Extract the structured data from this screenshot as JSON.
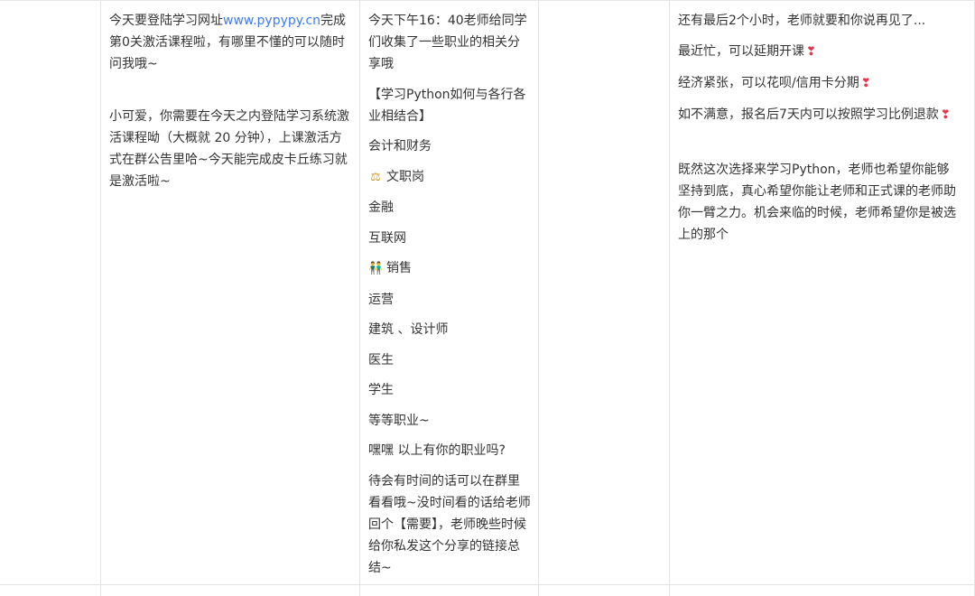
{
  "col1": {
    "p1_before": "今天要登陆学习网址",
    "p1_link": "www.pypypy.cn",
    "p1_after": "完成第0关激活课程啦，有哪里不懂的可以随时问我哦~",
    "p2": "小可爱，你需要在今天之内登陆学习系统激活课程呦（大概就 20 分钟），上课激活方式在群公告里哈~今天能完成皮卡丘练习就是激活啦~"
  },
  "col2": {
    "intro": "今天下午16：40老师给同学们收集了一些职业的相关分享哦",
    "heading": "【学习Python如何与各行各业相结合】",
    "items": [
      {
        "icon": "",
        "text": "会计和财务"
      },
      {
        "icon": "⚖",
        "text": "文职岗"
      },
      {
        "icon": "",
        "text": "金融"
      },
      {
        "icon": "",
        "text": "互联网"
      },
      {
        "icon": "👬",
        "text": "销售"
      },
      {
        "icon": "",
        "text": "运营"
      },
      {
        "icon": "",
        "text": "建筑 、设计师"
      },
      {
        "icon": "",
        "text": "医生"
      },
      {
        "icon": "",
        "text": "学生"
      },
      {
        "icon": "",
        "text": "等等职业~"
      }
    ],
    "question": "嘿嘿 以上有你的职业吗?",
    "closing": "待会有时间的话可以在群里看看哦~没时间看的话给老师回个【需要】，老师晚些时候给你私发这个分享的链接总结~"
  },
  "col4": {
    "p1": "还有最后2个小时，老师就要和你说再见了...",
    "p2": "最近忙，可以延期开课",
    "p3": "经济紧张，可以花呗/信用卡分期",
    "p4": "如不满意，报名后7天内可以按照学习比例退款",
    "heart": "❣",
    "p5": "既然这次选择来学习Python，老师也希望你能够坚持到底，真心希望你能让老师和正式课的老师助你一臂之力。机会来临的时候，老师希望你是被选上的那个"
  },
  "colors": {
    "link": "#3e7bf5",
    "heart": "#e8334d",
    "border": "#e3e3e3"
  }
}
